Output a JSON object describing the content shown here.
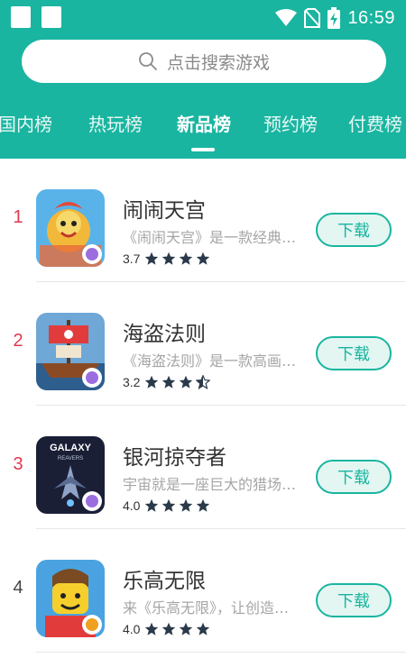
{
  "status_bar": {
    "time": "16:59"
  },
  "search": {
    "placeholder": "点击搜索游戏"
  },
  "tabs": [
    {
      "label": "国内榜",
      "active": false
    },
    {
      "label": "热玩榜",
      "active": false
    },
    {
      "label": "新品榜",
      "active": true
    },
    {
      "label": "预约榜",
      "active": false
    },
    {
      "label": "付费榜",
      "active": false
    }
  ],
  "apps": [
    {
      "rank": "1",
      "name": "闹闹天宫",
      "description": "《闹闹天宫》是一款经典西游",
      "rating": "3.7",
      "stars": 4,
      "download_label": "下载",
      "icon": "nao-nao-tian-gong-icon"
    },
    {
      "rank": "2",
      "name": "海盗法则",
      "description": "《海盗法则》是一款高画质策略",
      "rating": "3.2",
      "stars": 3.5,
      "download_label": "下载",
      "icon": "pirate-rules-icon"
    },
    {
      "rank": "3",
      "name": "银河掠夺者",
      "description": "宇宙就是一座巨大的猎场。在这",
      "rating": "4.0",
      "stars": 4,
      "download_label": "下载",
      "icon": "galaxy-reavers-icon"
    },
    {
      "rank": "4",
      "name": "乐高无限",
      "description": "来《乐高无限》，让创造无限可能",
      "rating": "4.0",
      "stars": 4,
      "download_label": "下载",
      "icon": "lego-infinite-icon"
    }
  ],
  "colors": {
    "accent": "#19b5a0",
    "rank_red": "#e0394f",
    "rank_gray": "#444444",
    "star": "#2b3a4a"
  }
}
